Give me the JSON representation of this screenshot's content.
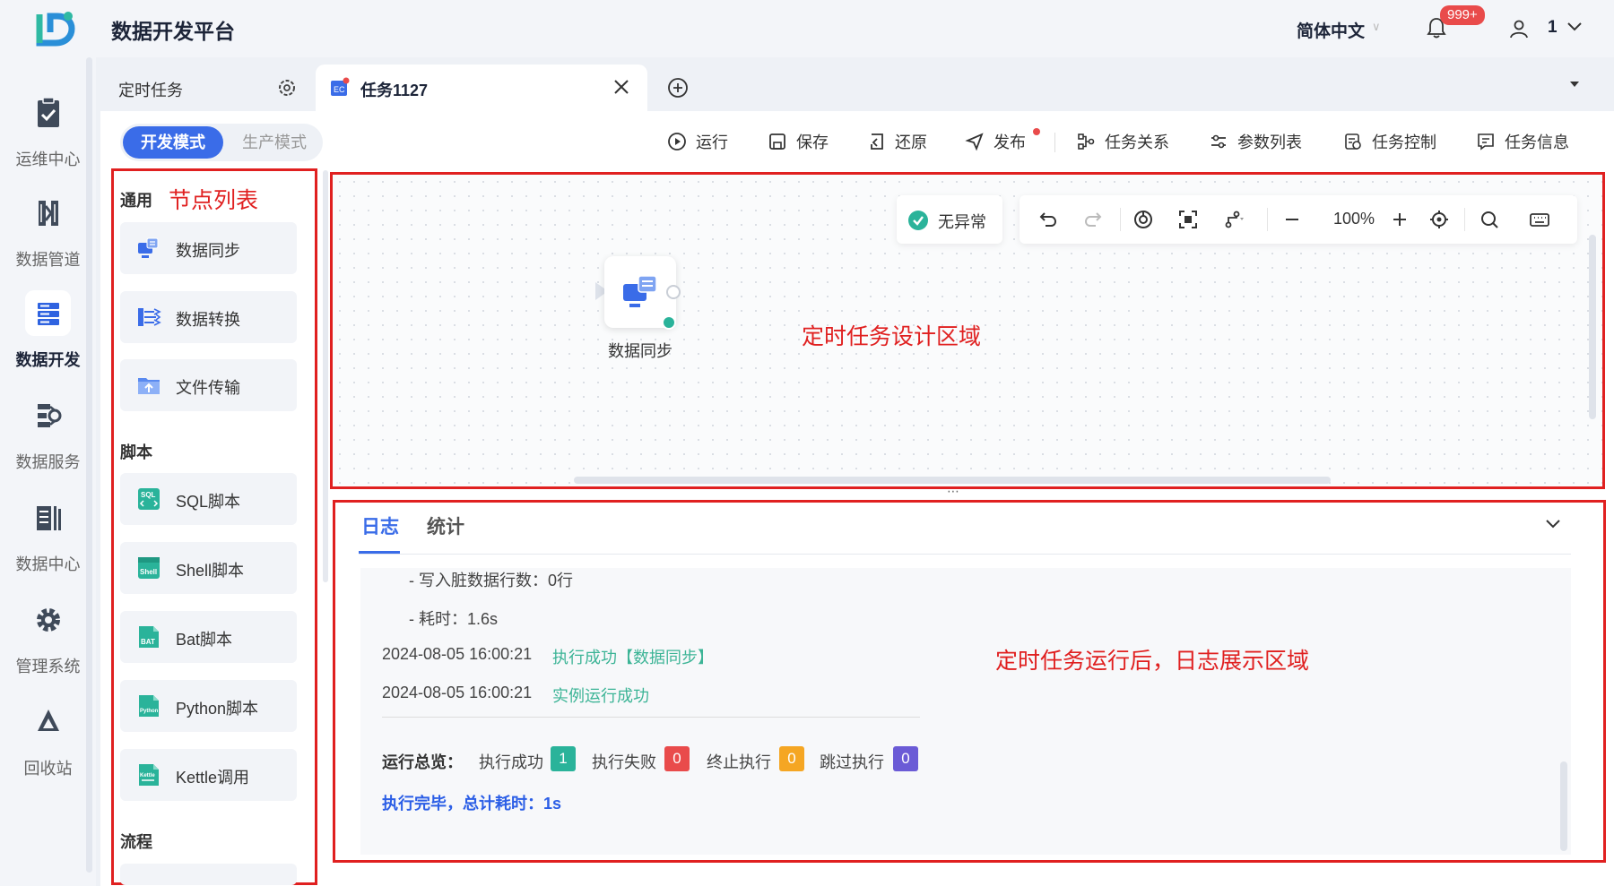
{
  "header": {
    "app_title": "数据开发平台",
    "language": "简体中文",
    "notifications_badge": "999+",
    "user_name": "1"
  },
  "nav": {
    "items": [
      {
        "label": "运维中心",
        "icon": "clipboard-check-icon",
        "active": false
      },
      {
        "label": "数据管道",
        "icon": "pipeline-icon",
        "active": false
      },
      {
        "label": "数据开发",
        "icon": "server-stack-icon",
        "active": true
      },
      {
        "label": "数据服务",
        "icon": "service-icon",
        "active": false
      },
      {
        "label": "数据中心",
        "icon": "data-center-icon",
        "active": false
      },
      {
        "label": "管理系统",
        "icon": "gear-icon",
        "active": false
      },
      {
        "label": "回收站",
        "icon": "recycle-icon",
        "active": false
      }
    ]
  },
  "tabs": {
    "first": "定时任务",
    "active": "任务1127"
  },
  "mode": {
    "dev": "开发模式",
    "prod": "生产模式"
  },
  "toolbar": {
    "run": "运行",
    "save": "保存",
    "restore": "还原",
    "publish": "发布",
    "relations": "任务关系",
    "params": "参数列表",
    "control": "任务控制",
    "info": "任务信息"
  },
  "panel": {
    "annotation": "节点列表",
    "sections": {
      "general": "通用",
      "script": "脚本",
      "flow": "流程"
    },
    "general_items": [
      "数据同步",
      "数据转换",
      "文件传输"
    ],
    "script_items": [
      "SQL脚本",
      "Shell脚本",
      "Bat脚本",
      "Python脚本",
      "Kettle调用"
    ]
  },
  "canvas": {
    "status": "无异常",
    "zoom": "100%",
    "node_label": "数据同步",
    "annotation": "定时任务设计区域"
  },
  "log": {
    "tabs": [
      "日志",
      "统计"
    ],
    "annotation": "定时任务运行后，日志展示区域",
    "lines": {
      "dirty_rows": "- 写入脏数据行数：0行",
      "duration": "- 耗时：1.6s",
      "ts1": "2024-08-05 16:00:21",
      "msg1": "执行成功【数据同步】",
      "ts2": "2024-08-05 16:00:21",
      "msg2": "实例运行成功"
    },
    "summary": {
      "title": "运行总览：",
      "success_label": "执行成功",
      "success_count": "1",
      "fail_label": "执行失败",
      "fail_count": "0",
      "stop_label": "终止执行",
      "stop_count": "0",
      "skip_label": "跳过执行",
      "skip_count": "0",
      "finish": "执行完毕，总计耗时：1s"
    }
  },
  "colors": {
    "accent": "#3a6ce8",
    "annotation_red": "#e02020",
    "success_green": "#3cb496",
    "count_success": "#2ab39a",
    "count_fail": "#e94b4b",
    "count_stop": "#f5a623",
    "count_skip": "#6b5bd6"
  }
}
